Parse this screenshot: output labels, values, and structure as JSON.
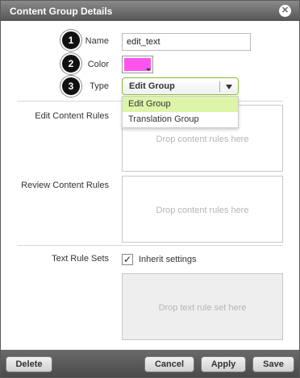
{
  "dialog": {
    "title": "Content Group Details",
    "close_icon": "close-icon"
  },
  "form": {
    "name": {
      "badge": "1",
      "label": "Name",
      "value": "edit_text"
    },
    "color": {
      "badge": "2",
      "label": "Color",
      "value": "#ff55ee"
    },
    "type": {
      "badge": "3",
      "label": "Type",
      "selected": "Edit Group",
      "options": [
        "Edit Group",
        "Translation Group"
      ]
    }
  },
  "rules": {
    "edit_label": "Edit Content Rules",
    "edit_placeholder": "Drop content rules here",
    "review_label": "Review Content Rules",
    "review_placeholder": "Drop content rules here"
  },
  "text_rules": {
    "label": "Text Rule Sets",
    "inherit_label": "Inherit settings",
    "inherit_checked": true,
    "placeholder": "Drop text rule set here"
  },
  "footer": {
    "delete": "Delete",
    "cancel": "Cancel",
    "apply": "Apply",
    "save": "Save"
  },
  "colors": {
    "titlebar": "#555555",
    "accent_green": "#88bb33",
    "selected_option": "#dcf5a8"
  }
}
